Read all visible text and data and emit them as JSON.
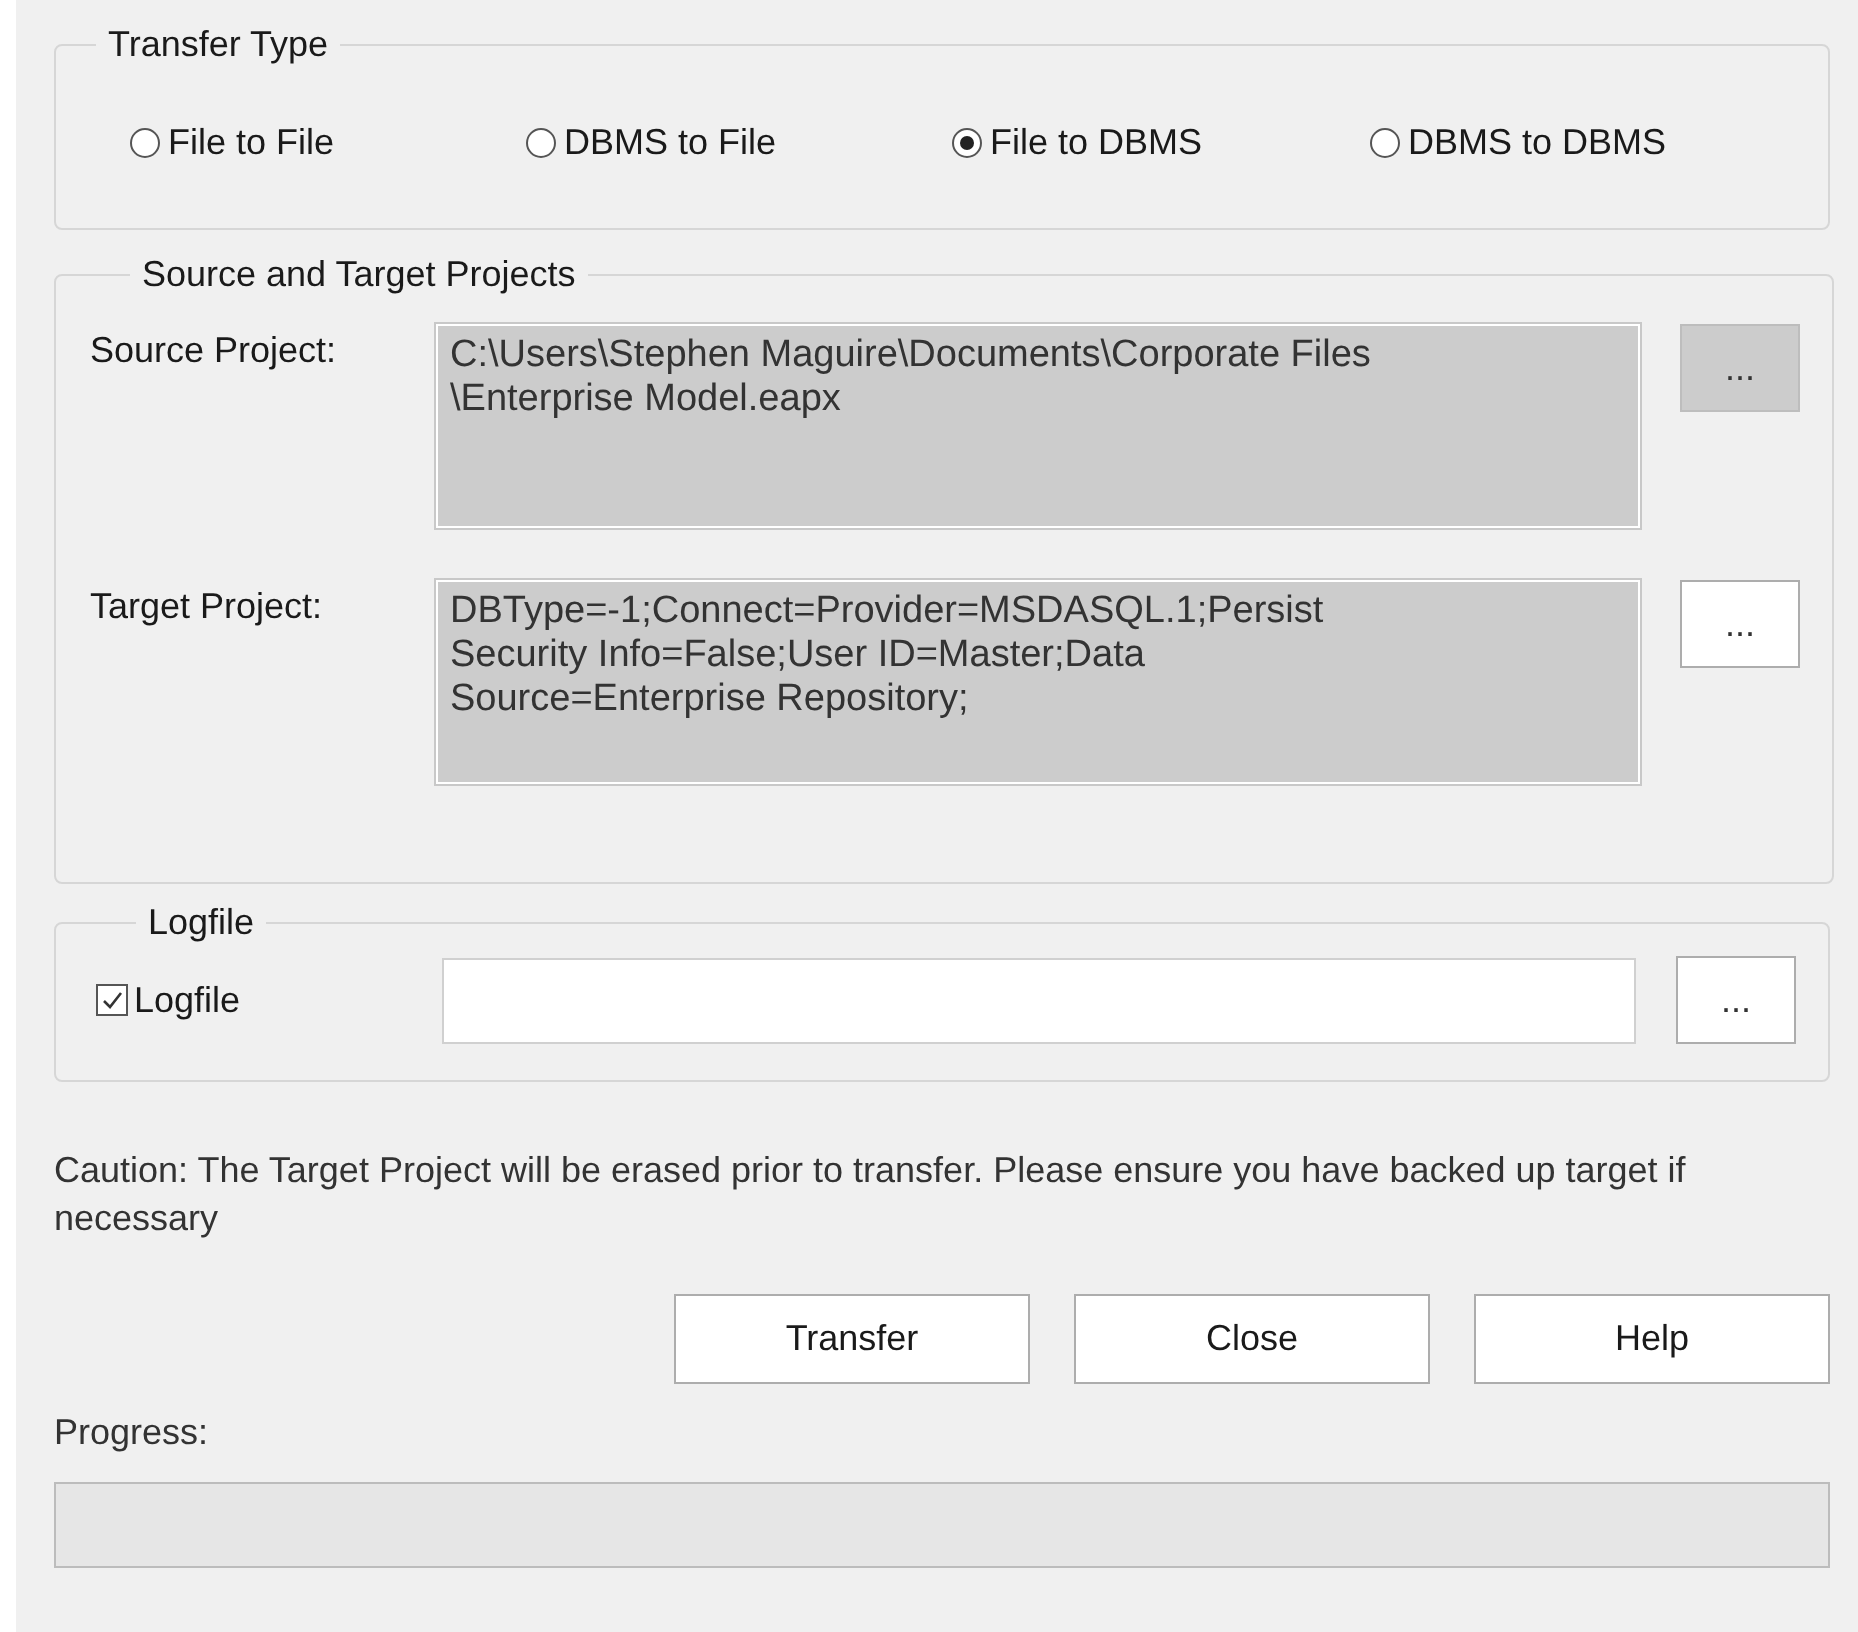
{
  "transfer_type": {
    "title": "Transfer Type",
    "options": [
      {
        "label": "File to File",
        "selected": false
      },
      {
        "label": "DBMS to File",
        "selected": false
      },
      {
        "label": "File to DBMS",
        "selected": true
      },
      {
        "label": "DBMS to DBMS",
        "selected": false
      }
    ]
  },
  "projects": {
    "title": "Source and Target Projects",
    "rows": [
      {
        "label": "Source Project:",
        "value_lines": [
          "C:\\Users\\Stephen Maguire\\Documents\\Corporate Files",
          "\\Enterprise Model.eapx"
        ],
        "browse_button": {
          "label": "...",
          "disabled": true
        }
      },
      {
        "label": "Target Project:",
        "value_lines": [
          "DBType=-1;Connect=Provider=MSDASQL.1;Persist",
          "Security Info=False;User ID=Master;Data",
          "Source=Enterprise Repository;"
        ],
        "browse_button": {
          "label": "...",
          "disabled": false
        }
      }
    ]
  },
  "logfile": {
    "title": "Logfile",
    "checkbox": {
      "label": "Logfile",
      "checked": true
    },
    "browse_button": {
      "label": "...",
      "disabled": false
    }
  },
  "caution": "Caution: The Target Project will be erased prior to transfer. Please ensure you have backed up target if necessary",
  "buttons": [
    "Transfer",
    "Close",
    "Help"
  ],
  "progress": {
    "label": "Progress:",
    "level": 0
  }
}
